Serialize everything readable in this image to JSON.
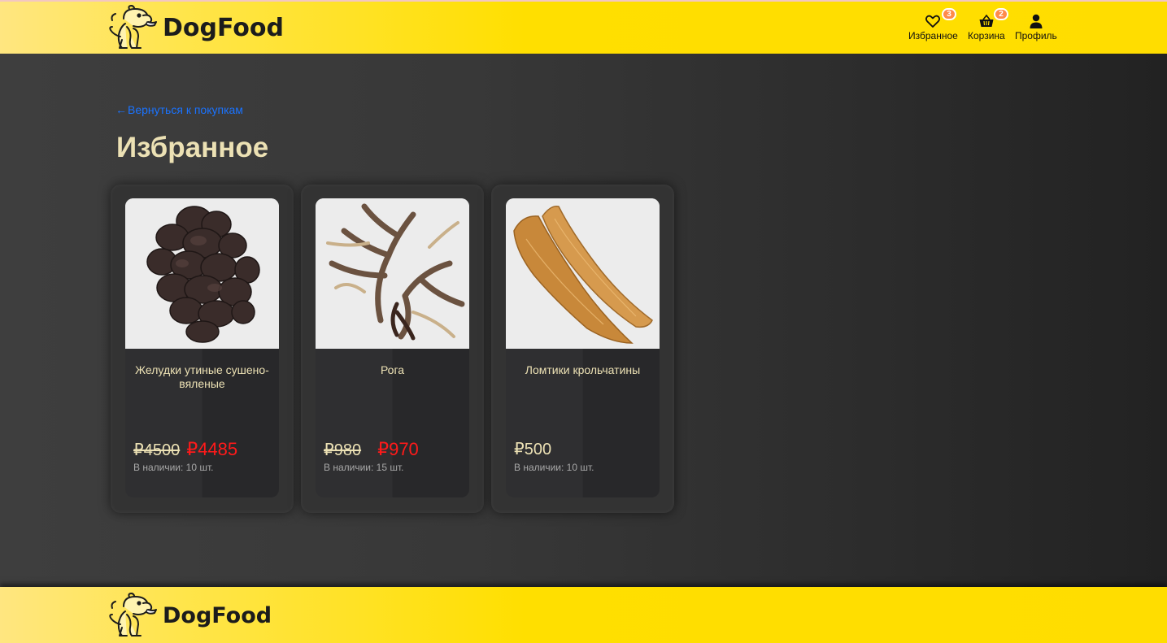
{
  "header": {
    "logo_text": "DogFood",
    "nav": {
      "favorites": {
        "label": "Избранное",
        "count": "3",
        "icon": "heart-icon"
      },
      "cart": {
        "label": "Корзина",
        "count": "2",
        "icon": "basket-icon"
      },
      "profile": {
        "label": "Профиль",
        "icon": "user-icon"
      }
    }
  },
  "main": {
    "back_link": "Вернуться к покупкам",
    "title": "Избранное",
    "products": [
      {
        "name": "Желудки утиные сушено-вяленые",
        "old_price": "₽4500",
        "price": "₽4485",
        "stock": "В наличии: 10 шт."
      },
      {
        "name": "Рога",
        "old_price": "₽980",
        "price": "₽970",
        "stock": "В наличии: 15 шт."
      },
      {
        "name": "Ломтики крольчатины",
        "price": "₽500",
        "stock": "В наличии: 10 шт."
      }
    ]
  },
  "footer": {
    "logo_text": "DogFood"
  },
  "colors": {
    "accent_yellow": "#ffdd00",
    "link_blue": "#1a73ff",
    "sale_red": "#ff1a1a",
    "text_cream": "#ece1b4"
  }
}
